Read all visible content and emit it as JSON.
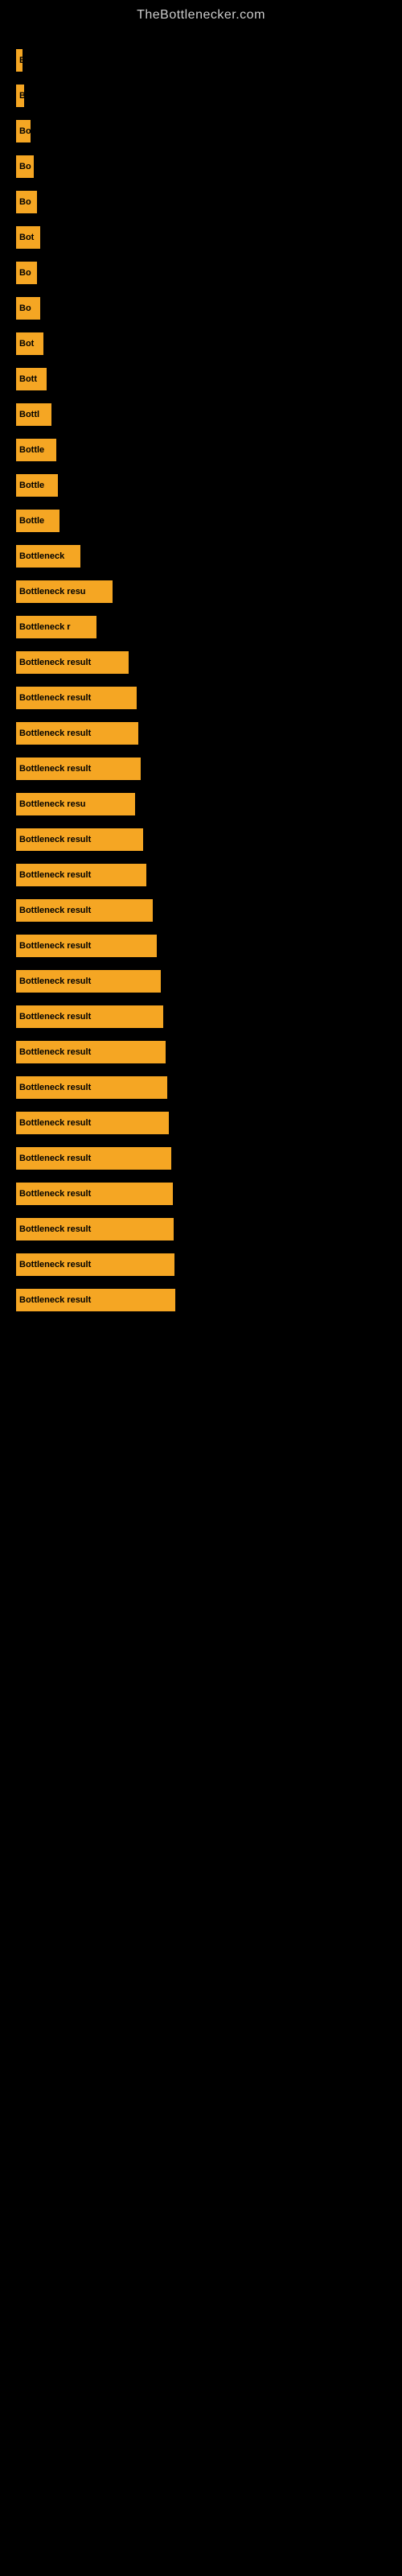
{
  "site": {
    "title": "TheBottlenecker.com"
  },
  "bars": [
    {
      "id": 1,
      "label": "B",
      "width": 8
    },
    {
      "id": 2,
      "label": "B",
      "width": 10
    },
    {
      "id": 3,
      "label": "Bo",
      "width": 18
    },
    {
      "id": 4,
      "label": "Bo",
      "width": 22
    },
    {
      "id": 5,
      "label": "Bo",
      "width": 26
    },
    {
      "id": 6,
      "label": "Bot",
      "width": 30
    },
    {
      "id": 7,
      "label": "Bo",
      "width": 26
    },
    {
      "id": 8,
      "label": "Bo",
      "width": 30
    },
    {
      "id": 9,
      "label": "Bot",
      "width": 34
    },
    {
      "id": 10,
      "label": "Bott",
      "width": 38
    },
    {
      "id": 11,
      "label": "Bottl",
      "width": 44
    },
    {
      "id": 12,
      "label": "Bottle",
      "width": 50
    },
    {
      "id": 13,
      "label": "Bottle",
      "width": 52
    },
    {
      "id": 14,
      "label": "Bottle",
      "width": 54
    },
    {
      "id": 15,
      "label": "Bottleneck",
      "width": 80
    },
    {
      "id": 16,
      "label": "Bottleneck resu",
      "width": 120
    },
    {
      "id": 17,
      "label": "Bottleneck r",
      "width": 100
    },
    {
      "id": 18,
      "label": "Bottleneck result",
      "width": 140
    },
    {
      "id": 19,
      "label": "Bottleneck result",
      "width": 150
    },
    {
      "id": 20,
      "label": "Bottleneck result",
      "width": 152
    },
    {
      "id": 21,
      "label": "Bottleneck result",
      "width": 155
    },
    {
      "id": 22,
      "label": "Bottleneck resu",
      "width": 148
    },
    {
      "id": 23,
      "label": "Bottleneck result",
      "width": 158
    },
    {
      "id": 24,
      "label": "Bottleneck result",
      "width": 162
    },
    {
      "id": 25,
      "label": "Bottleneck result",
      "width": 170
    },
    {
      "id": 26,
      "label": "Bottleneck result",
      "width": 175
    },
    {
      "id": 27,
      "label": "Bottleneck result",
      "width": 180
    },
    {
      "id": 28,
      "label": "Bottleneck result",
      "width": 183
    },
    {
      "id": 29,
      "label": "Bottleneck result",
      "width": 186
    },
    {
      "id": 30,
      "label": "Bottleneck result",
      "width": 188
    },
    {
      "id": 31,
      "label": "Bottleneck result",
      "width": 190
    },
    {
      "id": 32,
      "label": "Bottleneck result",
      "width": 193
    },
    {
      "id": 33,
      "label": "Bottleneck result",
      "width": 195
    },
    {
      "id": 34,
      "label": "Bottleneck result",
      "width": 196
    },
    {
      "id": 35,
      "label": "Bottleneck result",
      "width": 197
    },
    {
      "id": 36,
      "label": "Bottleneck result",
      "width": 198
    }
  ]
}
